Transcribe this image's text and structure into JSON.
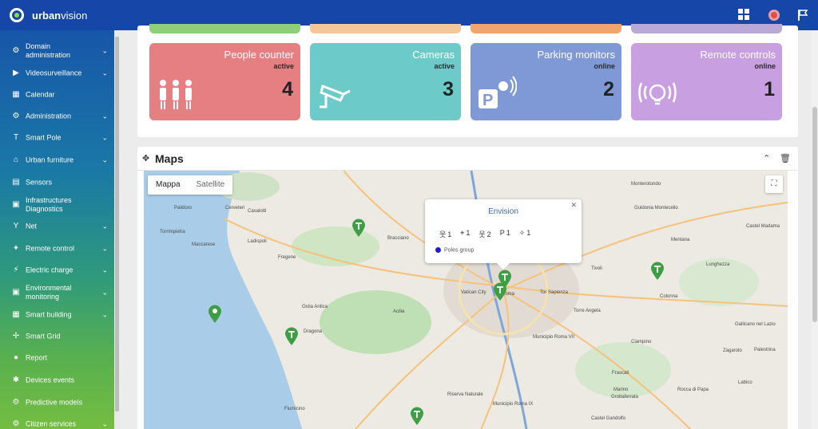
{
  "app": {
    "brand_bold": "urban",
    "brand_rest": "vision"
  },
  "sidebar": {
    "items": [
      {
        "label": "Domain administration",
        "icon": "users-cog-icon",
        "glyph": "⚙",
        "chevron": true
      },
      {
        "label": "Videosurveillance",
        "icon": "camera-icon",
        "glyph": "▶",
        "chevron": true
      },
      {
        "label": "Calendar",
        "icon": "calendar-icon",
        "glyph": "▦",
        "chevron": false
      },
      {
        "label": "Administration",
        "icon": "users-icon",
        "glyph": "⚙",
        "chevron": true
      },
      {
        "label": "Smart Pole",
        "icon": "pole-icon",
        "glyph": "T",
        "chevron": true
      },
      {
        "label": "Urban furniture",
        "icon": "bench-icon",
        "glyph": "⌂",
        "chevron": true
      },
      {
        "label": "Sensors",
        "icon": "sensor-icon",
        "glyph": "▤",
        "chevron": false
      },
      {
        "label": "Infrastructures Diagnostics",
        "icon": "diagnostics-icon",
        "glyph": "▣",
        "chevron": false
      },
      {
        "label": "Net",
        "icon": "net-icon",
        "glyph": "Y",
        "chevron": true
      },
      {
        "label": "Remote control",
        "icon": "remote-icon",
        "glyph": "✦",
        "chevron": true
      },
      {
        "label": "Electric charge",
        "icon": "charge-icon",
        "glyph": "⚡",
        "chevron": true
      },
      {
        "label": "Environmental monitoring",
        "icon": "environment-icon",
        "glyph": "▣",
        "chevron": true
      },
      {
        "label": "Smart building",
        "icon": "building-icon",
        "glyph": "▦",
        "chevron": true
      },
      {
        "label": "Smart Grid",
        "icon": "grid-icon",
        "glyph": "✢",
        "chevron": false
      },
      {
        "label": "Report",
        "icon": "report-icon",
        "glyph": "●",
        "chevron": false
      },
      {
        "label": "Devices events",
        "icon": "events-icon",
        "glyph": "✱",
        "chevron": false
      },
      {
        "label": "Predictive models",
        "icon": "model-icon",
        "glyph": "⚙",
        "chevron": false
      },
      {
        "label": "Citizen services",
        "icon": "citizen-icon",
        "glyph": "⚙",
        "chevron": true
      }
    ]
  },
  "tiles": [
    {
      "name": "People counter",
      "status": "active",
      "count": "4",
      "color": "#e57f82",
      "icon": "people-icon"
    },
    {
      "name": "Cameras",
      "status": "active",
      "count": "3",
      "color": "#6ccbc8",
      "icon": "camera-icon"
    },
    {
      "name": "Parking monitors",
      "status": "online",
      "count": "2",
      "color": "#7f99d6",
      "icon": "parking-icon"
    },
    {
      "name": "Remote controls",
      "status": "online",
      "count": "1",
      "color": "#c89fe0",
      "icon": "bulb-icon"
    }
  ],
  "prev_tile_colors": [
    "#8fcf7a",
    "#f3c79a",
    "#f1a46e",
    "#b9a9d8"
  ],
  "maps": {
    "title": "Maps",
    "tabs": [
      "Mappa",
      "Satellite"
    ],
    "popup": {
      "title": "Envision",
      "stats": [
        {
          "icon": "people-icon",
          "glyph": "웃",
          "value": "1"
        },
        {
          "icon": "camera-icon",
          "glyph": "⌖",
          "value": "1"
        },
        {
          "icon": "group-icon",
          "glyph": "웃",
          "value": "2"
        },
        {
          "icon": "parking-icon",
          "glyph": "P",
          "value": "1"
        },
        {
          "icon": "bulb-icon",
          "glyph": "✧",
          "value": "1"
        }
      ],
      "legend": "Poles group"
    },
    "labels": [
      {
        "text": "Cerveteri"
      },
      {
        "text": "Bracciano"
      },
      {
        "text": "Fregene"
      },
      {
        "text": "Roma"
      },
      {
        "text": "Fiumicino"
      },
      {
        "text": "Tivoli"
      },
      {
        "text": "Ciampino"
      },
      {
        "text": "Frascati"
      },
      {
        "text": "Marino"
      },
      {
        "text": "Colonna"
      },
      {
        "text": "Grottaferrata"
      },
      {
        "text": "Monterotondo"
      },
      {
        "text": "Guidonia Montecelio"
      },
      {
        "text": "Ostia Antica"
      },
      {
        "text": "Dragona"
      },
      {
        "text": "Palidoro"
      },
      {
        "text": "Castel Madama"
      },
      {
        "text": "Vatican City"
      },
      {
        "text": "Mentana"
      },
      {
        "text": "Zagarolo"
      },
      {
        "text": "Gallicano nel Lazio"
      },
      {
        "text": "Rocca di Papa"
      },
      {
        "text": "Palestrina"
      },
      {
        "text": "Labico"
      },
      {
        "text": "Acilia"
      },
      {
        "text": "Torre Angela"
      },
      {
        "text": "Lunghezza"
      },
      {
        "text": "Riserva Naturale"
      },
      {
        "text": "Municipio Roma VII"
      },
      {
        "text": "Municipio Roma IX"
      },
      {
        "text": "Tor Sapienza"
      },
      {
        "text": "Casalotti"
      },
      {
        "text": "Maccarese"
      },
      {
        "text": "Torrimpietra"
      },
      {
        "text": "Ladispoli"
      },
      {
        "text": "Castel Gandolfo"
      }
    ],
    "pins": [
      {
        "icon": "pole-icon"
      },
      {
        "icon": "pole-icon"
      },
      {
        "icon": "pole-icon"
      },
      {
        "icon": "pole-icon"
      },
      {
        "icon": "pole-icon"
      },
      {
        "icon": "pole-icon"
      },
      {
        "icon": "location-icon"
      },
      {
        "icon": "pole-icon"
      }
    ]
  }
}
